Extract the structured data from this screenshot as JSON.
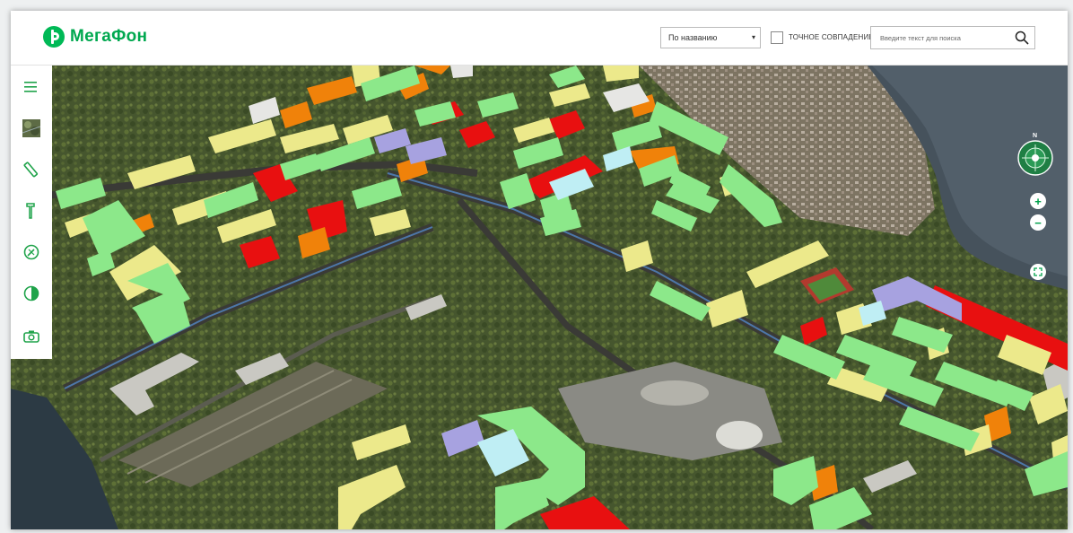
{
  "brand": {
    "name": "МегаФон",
    "color": "#00b956"
  },
  "search": {
    "sort_select": {
      "value": "По названию",
      "arrow": "▾"
    },
    "exact_match": {
      "label": "ТОЧНОЕ СОВПАДЕНИЕ",
      "checked": false
    },
    "input": {
      "placeholder": "Введите текст для поиска",
      "value": ""
    },
    "search_icon": "magnifier-icon"
  },
  "sidebar": {
    "items": [
      {
        "name": "menu",
        "icon": "hamburger-icon"
      },
      {
        "name": "satellite-layer",
        "icon": "satellite-thumbnail-icon"
      },
      {
        "name": "ruler",
        "icon": "ruler-icon"
      },
      {
        "name": "pin",
        "icon": "pin-icon"
      },
      {
        "name": "compass-tool",
        "icon": "compass-icon"
      },
      {
        "name": "contrast",
        "icon": "contrast-icon"
      },
      {
        "name": "camera",
        "icon": "camera-icon"
      }
    ]
  },
  "map_controls": {
    "compass_label": "N",
    "zoom_in": "+",
    "zoom_out": "−",
    "fullscreen_icon": "expand-icon"
  },
  "building_colors": {
    "high": "#e81010",
    "mid_high": "#f0820a",
    "mid": "#ece98b",
    "low": "#8ce88a",
    "special": "#a7a2e0",
    "cyan": "#bfeef4"
  }
}
